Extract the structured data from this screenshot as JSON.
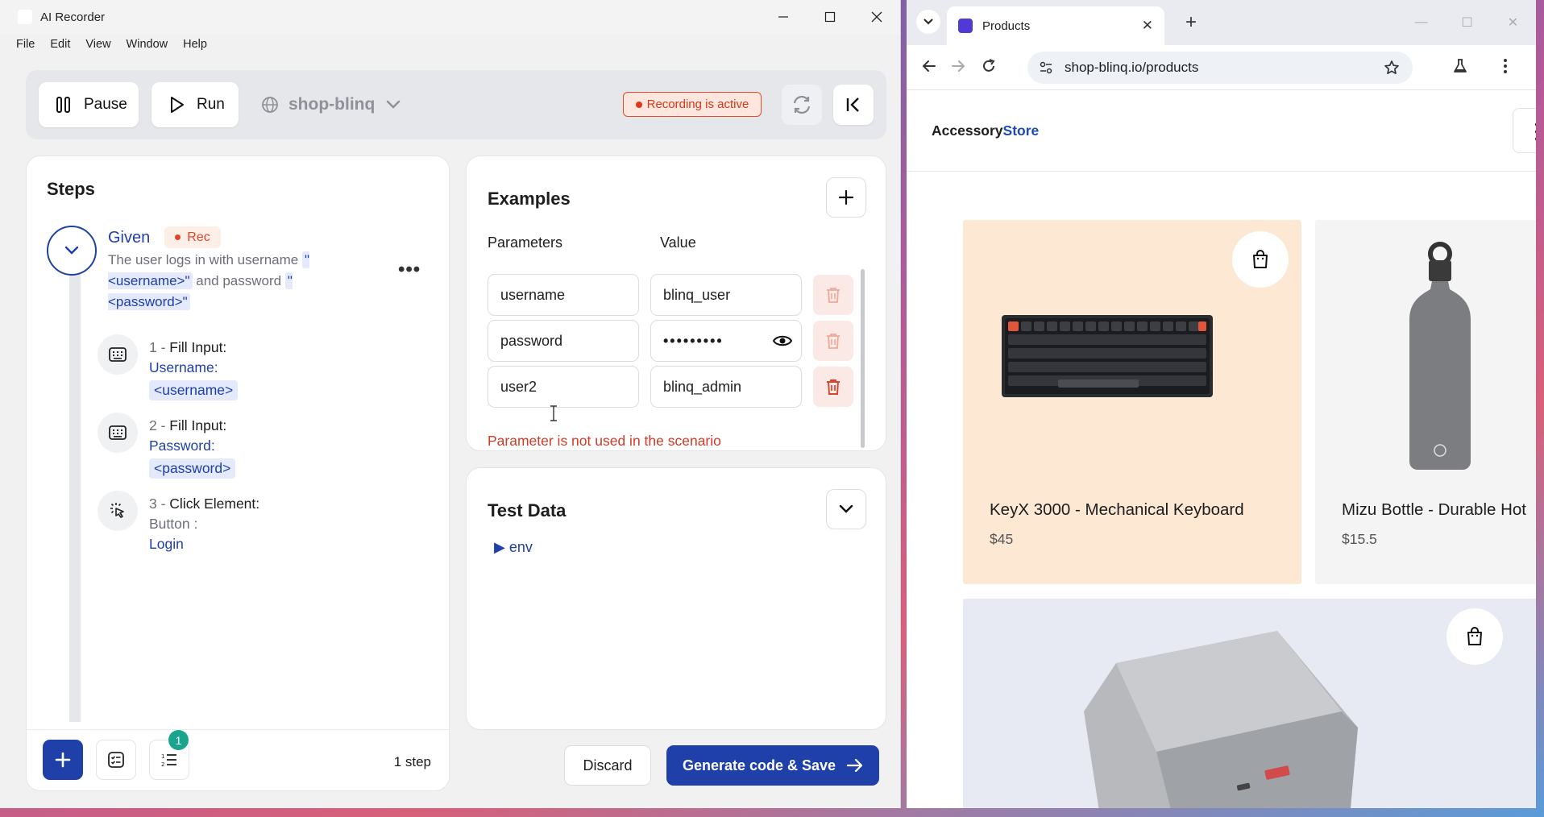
{
  "app": {
    "title": "AI Recorder",
    "menu": [
      "File",
      "Edit",
      "View",
      "Window",
      "Help"
    ]
  },
  "toolbar": {
    "pause_label": "Pause",
    "run_label": "Run",
    "project": "shop-blinq",
    "recording_status": "Recording is active"
  },
  "steps": {
    "title": "Steps",
    "given_label": "Given",
    "rec_label": "Rec",
    "desc_prefix": "The user logs in with username",
    "desc_param1": "\"<username>\"",
    "desc_mid": "and password",
    "desc_param2": "\"<password>\"",
    "items": [
      {
        "num": "1 - ",
        "action": "Fill Input:",
        "field": "Username:",
        "param": "<username>",
        "icon": "keyboard-icon"
      },
      {
        "num": "2 - ",
        "action": "Fill Input:",
        "field": "Password:",
        "param": "<password>",
        "icon": "keyboard-icon"
      },
      {
        "num": "3 - ",
        "action": "Click Element:",
        "field": "Button :",
        "param": "Login",
        "icon": "click-icon"
      }
    ],
    "badge_count": "1",
    "step_count": "1 step"
  },
  "examples": {
    "title": "Examples",
    "col_params": "Parameters",
    "col_value": "Value",
    "rows": [
      {
        "param": "username",
        "value": "blinq_user"
      },
      {
        "param": "password",
        "value": "•••••••••"
      },
      {
        "param": "user2",
        "value": "blinq_admin"
      }
    ],
    "error": "Parameter is not used in the scenario"
  },
  "test_data": {
    "title": "Test Data",
    "node": "env"
  },
  "actions": {
    "discard": "Discard",
    "generate": "Generate code & Save"
  },
  "browser": {
    "tab_title": "Products",
    "url": "shop-blinq.io/products",
    "logo_part1": "Accessory",
    "logo_part2": "Store",
    "products": [
      {
        "name": "KeyX 3000 - Mechanical Keyboard",
        "price": "$45"
      },
      {
        "name": "Mizu Bottle - Durable Hot",
        "price": "$15.5"
      }
    ]
  },
  "colors": {
    "accent": "#1e40a8",
    "recording": "#e44b2c",
    "error": "#d03a26",
    "badge": "#19a48e"
  }
}
